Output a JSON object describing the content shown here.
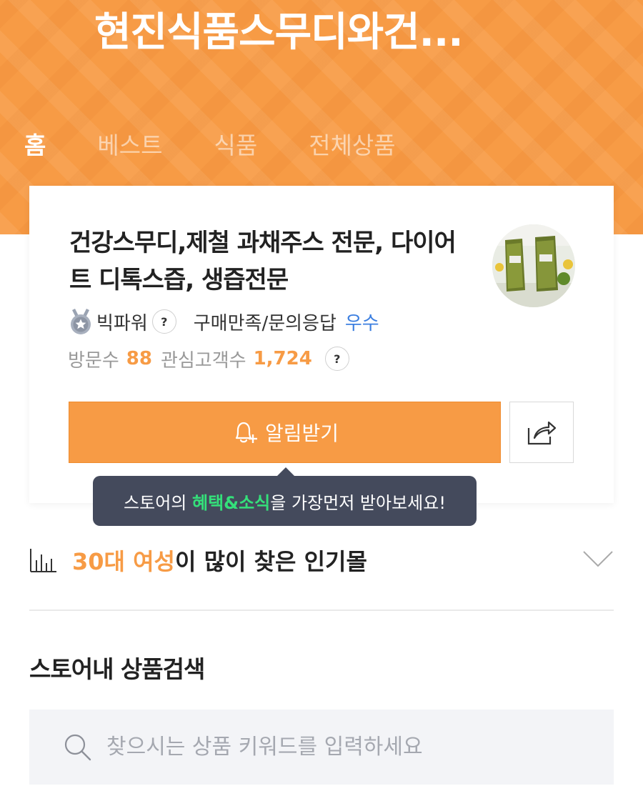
{
  "store": {
    "title": "현진식품스무디와건..."
  },
  "nav": {
    "tabs": [
      {
        "label": "홈",
        "active": true
      },
      {
        "label": "베스트",
        "active": false
      },
      {
        "label": "식품",
        "active": false
      },
      {
        "label": "전체상품",
        "active": false
      }
    ]
  },
  "profile": {
    "headline": "건강스무디,제철 과채주스 전문, 다이어트 디톡스즙, 생즙전문",
    "badge_label": "빅파워",
    "help_glyph": "?",
    "rating_label": "구매만족/문의응답",
    "rating_value": "우수",
    "visitors_label": "방문수",
    "visitors_value": "88",
    "followers_label": "관심고객수",
    "followers_value": "1,724"
  },
  "actions": {
    "notify_label": "알림받기",
    "share_icon": "share-icon"
  },
  "tooltip": {
    "prefix": "스토어의 ",
    "highlight": "혜택&소식",
    "suffix": "을 가장먼저 받아보세요!"
  },
  "popular": {
    "accent": "30대 여성",
    "rest": "이 많이 찾은 인기몰"
  },
  "search": {
    "heading": "스토어내 상품검색",
    "placeholder": "찾으시는 상품 키워드를 입력하세요"
  },
  "colors": {
    "brand": "#f79b45",
    "link": "#3c7fe0",
    "tooltip_bg": "#444a5c",
    "tooltip_highlight": "#34e07a"
  }
}
